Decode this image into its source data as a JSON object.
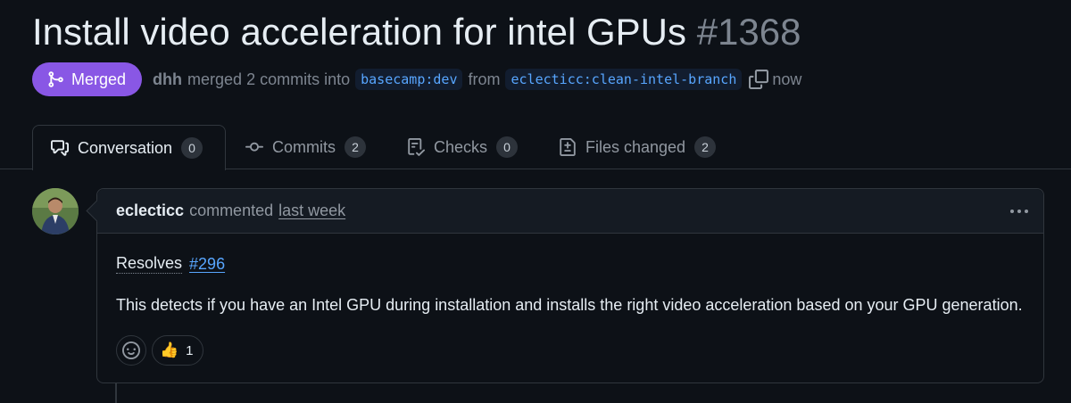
{
  "pr": {
    "title": "Install video acceleration for intel GPUs",
    "number": "#1368",
    "state": "Merged",
    "author": "dhh",
    "merged_text": "merged 2 commits into",
    "base_branch": "basecamp:dev",
    "from_text": "from",
    "head_branch": "eclecticc:clean-intel-branch",
    "time": "now"
  },
  "tabs": [
    {
      "label": "Conversation",
      "count": "0",
      "icon": "conversation-icon"
    },
    {
      "label": "Commits",
      "count": "2",
      "icon": "commit-icon"
    },
    {
      "label": "Checks",
      "count": "0",
      "icon": "checklist-icon"
    },
    {
      "label": "Files changed",
      "count": "2",
      "icon": "file-diff-icon"
    }
  ],
  "comment": {
    "author": "eclecticc",
    "action": "commented",
    "when": "last week",
    "resolves_label": "Resolves",
    "issue_ref": "#296",
    "body": "This detects if you have an Intel GPU during installation and installs the right video acceleration based on your GPU generation.",
    "reactions": [
      {
        "emoji": "👍",
        "count": "1"
      }
    ]
  },
  "colors": {
    "merged": "#8957e5",
    "link": "#58a6ff",
    "background": "#0d1117",
    "border": "#30363d"
  }
}
